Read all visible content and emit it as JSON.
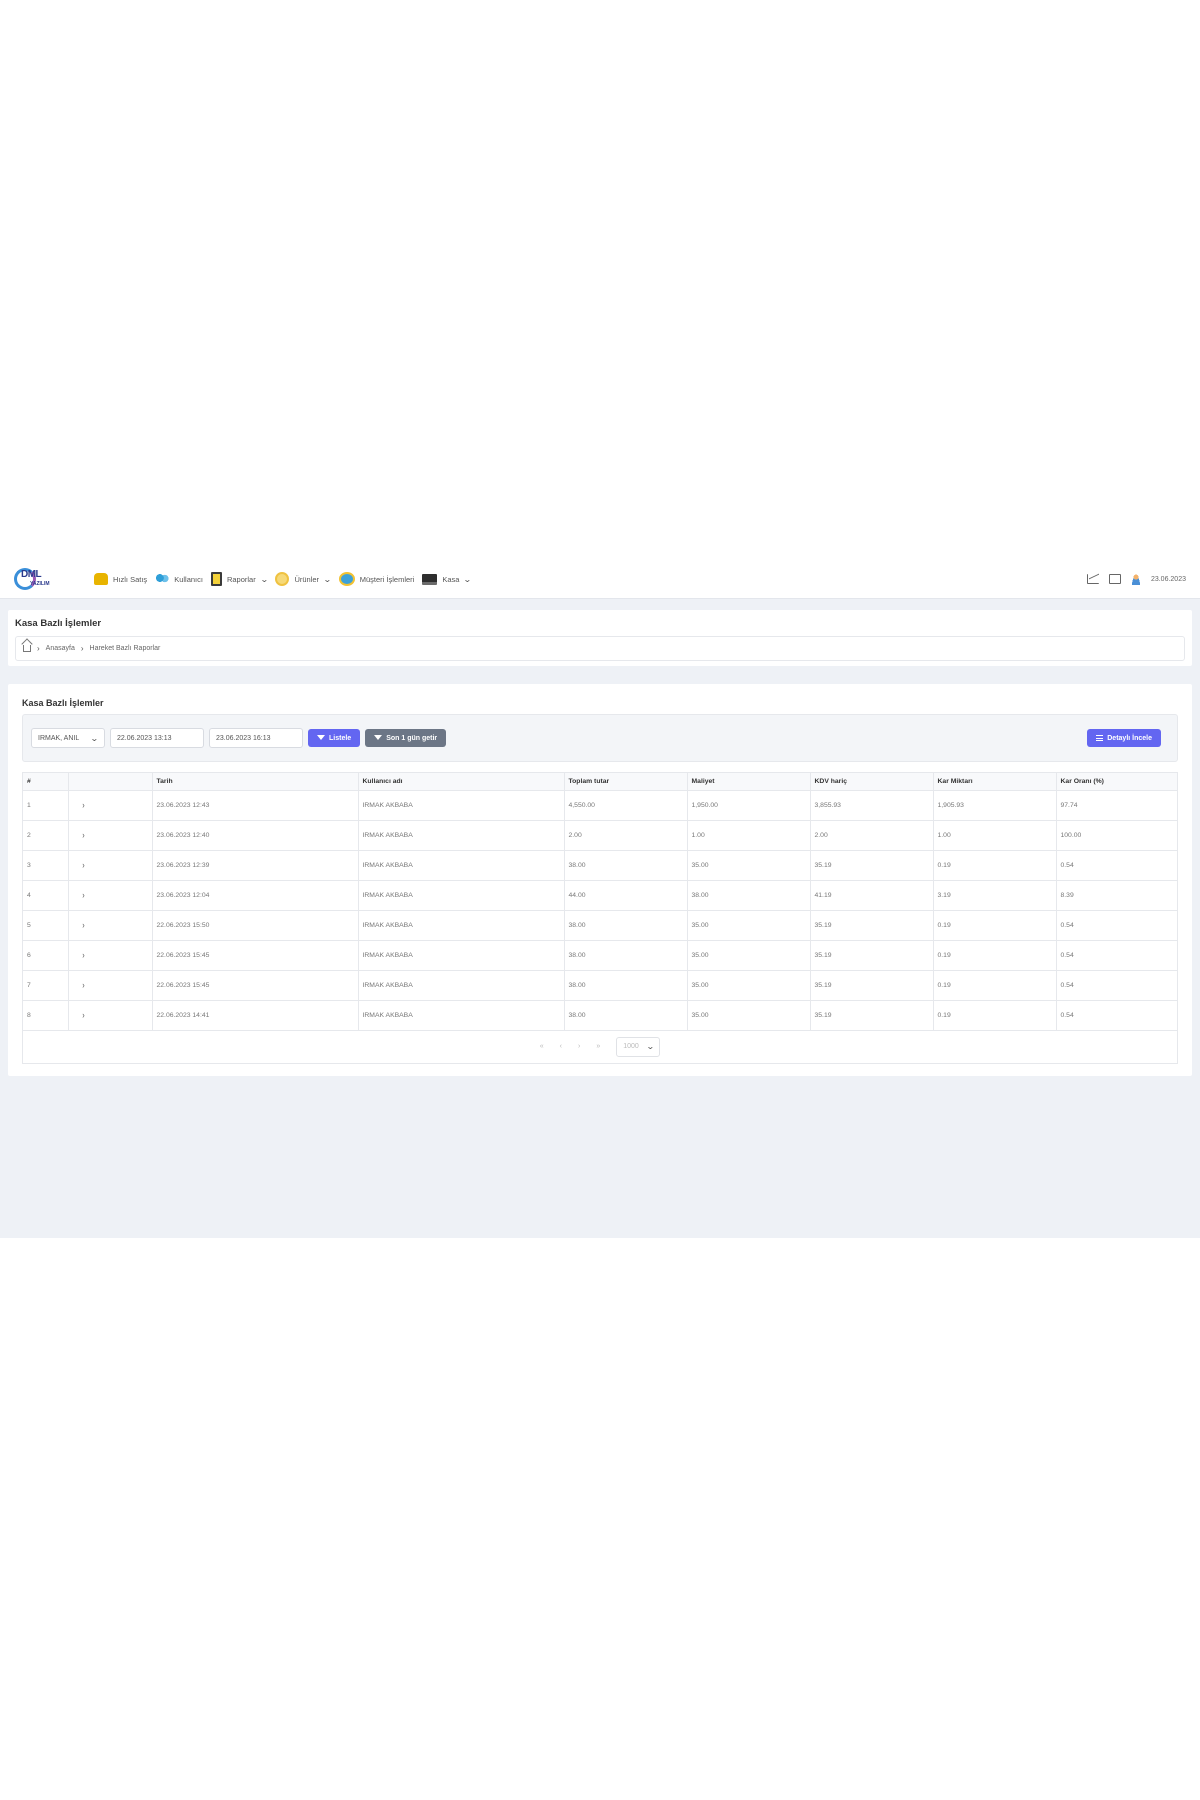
{
  "nav": {
    "logo": {
      "text": "DML",
      "sub": "YAZILIM"
    },
    "items": [
      {
        "label": "Hızlı Satış",
        "icon": "cart-icon",
        "has_dropdown": false
      },
      {
        "label": "Kullanıcı",
        "icon": "users-icon",
        "has_dropdown": false
      },
      {
        "label": "Raporlar",
        "icon": "report-icon",
        "has_dropdown": true
      },
      {
        "label": "Ürünler",
        "icon": "products-icon",
        "has_dropdown": true
      },
      {
        "label": "Müşteri İşlemleri",
        "icon": "customer-icon",
        "has_dropdown": false
      },
      {
        "label": "Kasa",
        "icon": "cash-register-icon",
        "has_dropdown": true
      }
    ],
    "date": "23.06.2023"
  },
  "header": {
    "title": "Kasa Bazlı İşlemler",
    "breadcrumb": [
      "Anasayfa",
      "Hareket Bazlı Raporlar"
    ]
  },
  "main": {
    "title": "Kasa Bazlı İşlemler",
    "filters": {
      "user_select": "IRMAK, ANIL",
      "start_date": "22.06.2023 13:13",
      "end_date": "23.06.2023 16:13",
      "list_button": "Listele",
      "last_day_button": "Son 1 gün getir",
      "detail_button": "Detaylı İncele"
    },
    "table": {
      "columns": [
        "#",
        "",
        "Tarih",
        "Kullanıcı adı",
        "Toplam tutar",
        "Maliyet",
        "KDV hariç",
        "Kar Miktarı",
        "Kar Oranı (%)"
      ],
      "rows": [
        [
          "1",
          "23.06.2023 12:43",
          "IRMAK   AKBABA",
          "4,550.00",
          "1,950.00",
          "3,855.93",
          "1,905.93",
          "97.74"
        ],
        [
          "2",
          "23.06.2023 12:40",
          "IRMAK   AKBABA",
          "2.00",
          "1.00",
          "2.00",
          "1.00",
          "100.00"
        ],
        [
          "3",
          "23.06.2023 12:39",
          "IRMAK   AKBABA",
          "38.00",
          "35.00",
          "35.19",
          "0.19",
          "0.54"
        ],
        [
          "4",
          "23.06.2023 12:04",
          "IRMAK   AKBABA",
          "44.00",
          "38.00",
          "41.19",
          "3.19",
          "8.39"
        ],
        [
          "5",
          "22.06.2023 15:50",
          "IRMAK   AKBABA",
          "38.00",
          "35.00",
          "35.19",
          "0.19",
          "0.54"
        ],
        [
          "6",
          "22.06.2023 15:45",
          "IRMAK   AKBABA",
          "38.00",
          "35.00",
          "35.19",
          "0.19",
          "0.54"
        ],
        [
          "7",
          "22.06.2023 15:45",
          "IRMAK   AKBABA",
          "38.00",
          "35.00",
          "35.19",
          "0.19",
          "0.54"
        ],
        [
          "8",
          "22.06.2023 14:41",
          "IRMAK   AKBABA",
          "38.00",
          "35.00",
          "35.19",
          "0.19",
          "0.54"
        ]
      ]
    },
    "pager": {
      "first": "«",
      "prev": "‹",
      "next": "›",
      "last": "»",
      "page_size": "1000"
    }
  },
  "colors": {
    "accent": "#6366f1",
    "secondary": "#6c7686",
    "background": "#eef1f6"
  }
}
